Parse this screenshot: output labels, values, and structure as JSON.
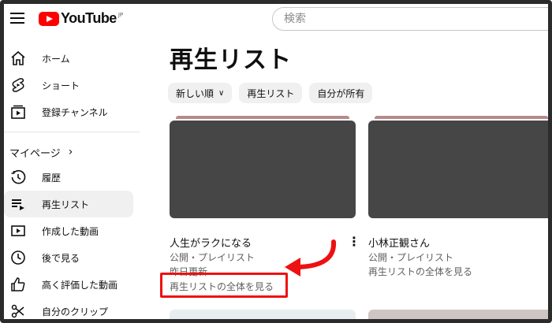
{
  "header": {
    "logo_text": "YouTube",
    "logo_sup": "JP",
    "search_placeholder": "検索"
  },
  "sidebar": {
    "items": [
      {
        "label": "ホーム",
        "icon": "home-icon"
      },
      {
        "label": "ショート",
        "icon": "shorts-icon"
      },
      {
        "label": "登録チャンネル",
        "icon": "subscriptions-icon"
      }
    ],
    "section_title": "マイページ",
    "section_chevron": "›",
    "my_items": [
      {
        "label": "履歴",
        "icon": "history-icon"
      },
      {
        "label": "再生リスト",
        "icon": "playlists-icon",
        "active": true
      },
      {
        "label": "作成した動画",
        "icon": "your-videos-icon"
      },
      {
        "label": "後で見る",
        "icon": "watch-later-icon"
      },
      {
        "label": "高く評価した動画",
        "icon": "liked-videos-icon"
      },
      {
        "label": "自分のクリップ",
        "icon": "clips-icon"
      }
    ]
  },
  "main": {
    "title": "再生リスト",
    "chips": [
      {
        "label": "新しい順",
        "has_caret": true
      },
      {
        "label": "再生リスト"
      },
      {
        "label": "自分が所有"
      }
    ],
    "cards": [
      {
        "title": "人生がラクになる",
        "visibility": "公開・プレイリスト",
        "updated": "昨日更新",
        "view_all": "再生リストの全体を見る"
      },
      {
        "title": "小林正観さん",
        "visibility": "公開・プレイリスト",
        "view_all": "再生リストの全体を見る"
      }
    ]
  },
  "annotation": {
    "highlight_color": "#ee1111"
  }
}
